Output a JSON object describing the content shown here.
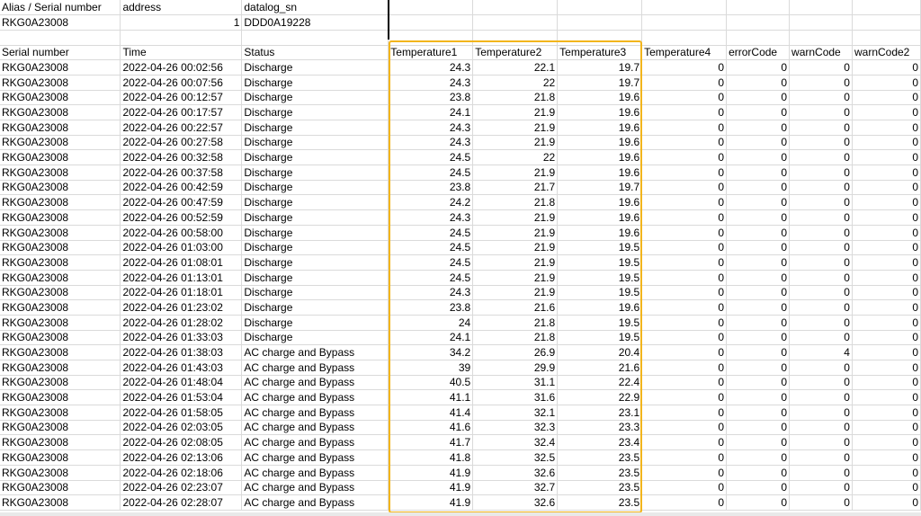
{
  "meta_header": {
    "row1": [
      "Alias / Serial number",
      "address",
      "datalog_sn",
      "",
      "",
      "",
      "",
      "",
      ""
    ],
    "row2": [
      "RKG0A23008",
      "1",
      "DDD0A19228",
      "",
      "",
      "",
      "",
      "",
      ""
    ]
  },
  "columns": [
    "Serial number",
    "Time",
    "Status",
    "Temperature1",
    "Temperature2",
    "Temperature3",
    "Temperature4",
    "errorCode",
    "warnCode",
    "warnCode2"
  ],
  "rows": [
    [
      "RKG0A23008",
      "2022-04-26 00:02:56",
      "Discharge",
      "24.3",
      "22.1",
      "19.7",
      "0",
      "0",
      "0",
      "0"
    ],
    [
      "RKG0A23008",
      "2022-04-26 00:07:56",
      "Discharge",
      "24.3",
      "22",
      "19.7",
      "0",
      "0",
      "0",
      "0"
    ],
    [
      "RKG0A23008",
      "2022-04-26 00:12:57",
      "Discharge",
      "23.8",
      "21.8",
      "19.6",
      "0",
      "0",
      "0",
      "0"
    ],
    [
      "RKG0A23008",
      "2022-04-26 00:17:57",
      "Discharge",
      "24.1",
      "21.9",
      "19.6",
      "0",
      "0",
      "0",
      "0"
    ],
    [
      "RKG0A23008",
      "2022-04-26 00:22:57",
      "Discharge",
      "24.3",
      "21.9",
      "19.6",
      "0",
      "0",
      "0",
      "0"
    ],
    [
      "RKG0A23008",
      "2022-04-26 00:27:58",
      "Discharge",
      "24.3",
      "21.9",
      "19.6",
      "0",
      "0",
      "0",
      "0"
    ],
    [
      "RKG0A23008",
      "2022-04-26 00:32:58",
      "Discharge",
      "24.5",
      "22",
      "19.6",
      "0",
      "0",
      "0",
      "0"
    ],
    [
      "RKG0A23008",
      "2022-04-26 00:37:58",
      "Discharge",
      "24.5",
      "21.9",
      "19.6",
      "0",
      "0",
      "0",
      "0"
    ],
    [
      "RKG0A23008",
      "2022-04-26 00:42:59",
      "Discharge",
      "23.8",
      "21.7",
      "19.7",
      "0",
      "0",
      "0",
      "0"
    ],
    [
      "RKG0A23008",
      "2022-04-26 00:47:59",
      "Discharge",
      "24.2",
      "21.8",
      "19.6",
      "0",
      "0",
      "0",
      "0"
    ],
    [
      "RKG0A23008",
      "2022-04-26 00:52:59",
      "Discharge",
      "24.3",
      "21.9",
      "19.6",
      "0",
      "0",
      "0",
      "0"
    ],
    [
      "RKG0A23008",
      "2022-04-26 00:58:00",
      "Discharge",
      "24.5",
      "21.9",
      "19.6",
      "0",
      "0",
      "0",
      "0"
    ],
    [
      "RKG0A23008",
      "2022-04-26 01:03:00",
      "Discharge",
      "24.5",
      "21.9",
      "19.5",
      "0",
      "0",
      "0",
      "0"
    ],
    [
      "RKG0A23008",
      "2022-04-26 01:08:01",
      "Discharge",
      "24.5",
      "21.9",
      "19.5",
      "0",
      "0",
      "0",
      "0"
    ],
    [
      "RKG0A23008",
      "2022-04-26 01:13:01",
      "Discharge",
      "24.5",
      "21.9",
      "19.5",
      "0",
      "0",
      "0",
      "0"
    ],
    [
      "RKG0A23008",
      "2022-04-26 01:18:01",
      "Discharge",
      "24.3",
      "21.9",
      "19.5",
      "0",
      "0",
      "0",
      "0"
    ],
    [
      "RKG0A23008",
      "2022-04-26 01:23:02",
      "Discharge",
      "23.8",
      "21.6",
      "19.6",
      "0",
      "0",
      "0",
      "0"
    ],
    [
      "RKG0A23008",
      "2022-04-26 01:28:02",
      "Discharge",
      "24",
      "21.8",
      "19.5",
      "0",
      "0",
      "0",
      "0"
    ],
    [
      "RKG0A23008",
      "2022-04-26 01:33:03",
      "Discharge",
      "24.1",
      "21.8",
      "19.5",
      "0",
      "0",
      "0",
      "0"
    ],
    [
      "RKG0A23008",
      "2022-04-26 01:38:03",
      "AC charge and Bypass",
      "34.2",
      "26.9",
      "20.4",
      "0",
      "0",
      "4",
      "0"
    ],
    [
      "RKG0A23008",
      "2022-04-26 01:43:03",
      "AC charge and Bypass",
      "39",
      "29.9",
      "21.6",
      "0",
      "0",
      "0",
      "0"
    ],
    [
      "RKG0A23008",
      "2022-04-26 01:48:04",
      "AC charge and Bypass",
      "40.5",
      "31.1",
      "22.4",
      "0",
      "0",
      "0",
      "0"
    ],
    [
      "RKG0A23008",
      "2022-04-26 01:53:04",
      "AC charge and Bypass",
      "41.1",
      "31.6",
      "22.9",
      "0",
      "0",
      "0",
      "0"
    ],
    [
      "RKG0A23008",
      "2022-04-26 01:58:05",
      "AC charge and Bypass",
      "41.4",
      "32.1",
      "23.1",
      "0",
      "0",
      "0",
      "0"
    ],
    [
      "RKG0A23008",
      "2022-04-26 02:03:05",
      "AC charge and Bypass",
      "41.6",
      "32.3",
      "23.3",
      "0",
      "0",
      "0",
      "0"
    ],
    [
      "RKG0A23008",
      "2022-04-26 02:08:05",
      "AC charge and Bypass",
      "41.7",
      "32.4",
      "23.4",
      "0",
      "0",
      "0",
      "0"
    ],
    [
      "RKG0A23008",
      "2022-04-26 02:13:06",
      "AC charge and Bypass",
      "41.8",
      "32.5",
      "23.5",
      "0",
      "0",
      "0",
      "0"
    ],
    [
      "RKG0A23008",
      "2022-04-26 02:18:06",
      "AC charge and Bypass",
      "41.9",
      "32.6",
      "23.5",
      "0",
      "0",
      "0",
      "0"
    ],
    [
      "RKG0A23008",
      "2022-04-26 02:23:07",
      "AC charge and Bypass",
      "41.9",
      "32.7",
      "23.5",
      "0",
      "0",
      "0",
      "0"
    ],
    [
      "RKG0A23008",
      "2022-04-26 02:28:07",
      "AC charge and Bypass",
      "41.9",
      "32.6",
      "23.5",
      "0",
      "0",
      "0",
      "0"
    ]
  ],
  "highlight": {
    "columns": [
      "Temperature1",
      "Temperature2",
      "Temperature3"
    ],
    "color": "#f2b51c"
  },
  "colors": {
    "gridline": "#dadada",
    "text": "#000000"
  }
}
